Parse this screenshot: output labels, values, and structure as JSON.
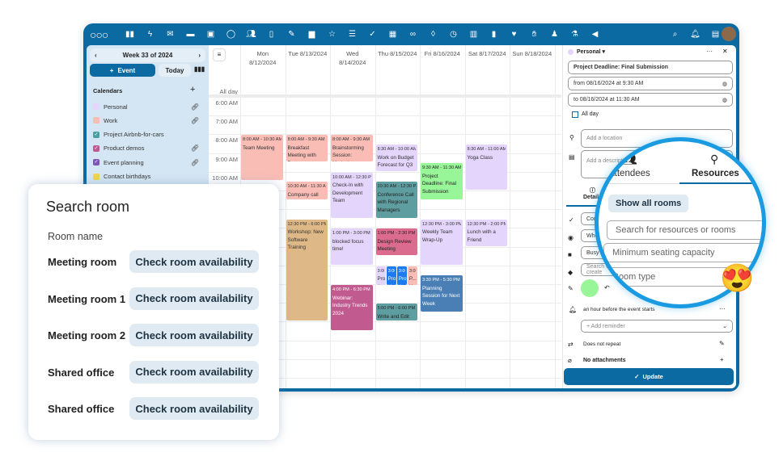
{
  "topbar": {
    "apps": [
      "dashboard-icon",
      "activity-icon",
      "mail-icon",
      "files-icon",
      "photos-icon",
      "talk-icon",
      "contacts-icon",
      "calendar-icon",
      "notes-icon",
      "deck-icon",
      "starred-icon",
      "tasks-icon",
      "check-icon",
      "tables-icon",
      "link-icon",
      "maps-icon",
      "speed-icon",
      "transport-icon",
      "bag-icon",
      "health-icon",
      "gestures-icon",
      "user-icon",
      "microscope-icon",
      "announce-icon"
    ],
    "right": [
      "search-icon",
      "notifications-icon",
      "contacts-menu-icon"
    ]
  },
  "sidebar": {
    "week": "Week 33 of 2024",
    "new_event": "Event",
    "today": "Today",
    "calendars_title": "Calendars",
    "calendars": [
      {
        "label": "Personal",
        "color": "#e3d5fb",
        "checked": false,
        "shared": true
      },
      {
        "label": "Work",
        "color": "#f9bdb6",
        "checked": false,
        "shared": true
      },
      {
        "label": "Project Airbnb-for-cars",
        "color": "#4aa0a0",
        "checked": true,
        "shared": false
      },
      {
        "label": "Product demos",
        "color": "#c05a8f",
        "checked": true,
        "shared": true
      },
      {
        "label": "Event planning",
        "color": "#7d55b5",
        "checked": true,
        "shared": true
      },
      {
        "label": "Contact birthdays",
        "color": "#f0d64a",
        "checked": false,
        "shared": false
      }
    ]
  },
  "grid": {
    "allday": "All day",
    "days": [
      [
        "Mon",
        "8/12/2024"
      ],
      [
        "Tue 8/13/2024",
        ""
      ],
      [
        "Wed",
        "8/14/2024"
      ],
      [
        "Thu 8/15/2024",
        ""
      ],
      [
        "Fri 8/16/2024",
        ""
      ],
      [
        "Sat 8/17/2024",
        ""
      ],
      [
        "Sun 8/18/2024",
        ""
      ]
    ],
    "times": [
      "6:00 AM",
      "7:00 AM",
      "8:00 AM",
      "9:00 AM",
      "10:00 AM"
    ],
    "events": [
      {
        "day": 0,
        "start": 8,
        "end": 10.5,
        "time": "8:00 AM - 10:30 AM",
        "title": "Team Meeting",
        "color": "#f9bdb6",
        "fg": "#333"
      },
      {
        "day": 1,
        "start": 8,
        "end": 9.5,
        "time": "8:00 AM - 9:30 AM",
        "title": "Breakfast Meeting with Partners",
        "color": "#f9bdb6",
        "fg": "#333"
      },
      {
        "day": 1,
        "start": 10.5,
        "end": 11.5,
        "time": "10:30 AM - 11:30 AM",
        "title": "Company call",
        "color": "#f9bdb6",
        "fg": "#333"
      },
      {
        "day": 1,
        "start": 12.5,
        "end": 18,
        "time": "12:30 PM - 6:00 PM",
        "title": "Workshop: New Software Training",
        "color": "#deb887",
        "fg": "#333"
      },
      {
        "day": 2,
        "start": 8,
        "end": 9.5,
        "time": "8:00 AM - 9:30 AM",
        "title": "Brainstorming Session: Marketing",
        "color": "#f9bdb6",
        "fg": "#333"
      },
      {
        "day": 2,
        "start": 10,
        "end": 12.5,
        "time": "10:00 AM - 12:30 PM",
        "title": "Check-In with Development Team",
        "color": "#e3d5fb",
        "fg": "#333"
      },
      {
        "day": 2,
        "start": 13,
        "end": 15,
        "time": "1:00 PM - 3:00 PM",
        "title": "blocked focus time!",
        "color": "#e3d5fb",
        "fg": "#333"
      },
      {
        "day": 2,
        "start": 16,
        "end": 18.5,
        "time": "4:00 PM - 6:30 PM",
        "title": "Webinar: Industry Trends 2024",
        "color": "#c05a8f",
        "fg": "#fff"
      },
      {
        "day": 3,
        "start": 8.5,
        "end": 10,
        "time": "8:30 AM - 10:00 AM",
        "title": "Work on Budget Forecast for Q3",
        "color": "#e3d5fb",
        "fg": "#333"
      },
      {
        "day": 3,
        "start": 10.5,
        "end": 12.5,
        "time": "10:30 AM - 12:30 PM",
        "title": "Conference Call with Regional Managers",
        "color": "#5f9ea0",
        "fg": "#222"
      },
      {
        "day": 3,
        "start": 13,
        "end": 14.5,
        "time": "1:00 PM - 2:30 PM",
        "title": "Design Review Meeting",
        "color": "#db6b8f",
        "fg": "#222"
      },
      {
        "day": 3,
        "start": 15,
        "end": 16.1,
        "time": "3:00",
        "title": "Pro the",
        "color": "#e3d5fb",
        "fg": "#333",
        "slot": 0,
        "slots": 4
      },
      {
        "day": 3,
        "start": 15,
        "end": 16.1,
        "time": "3:00",
        "title": "Pro Kick",
        "color": "#1a7cf0",
        "fg": "#fff",
        "slot": 1,
        "slots": 4
      },
      {
        "day": 3,
        "start": 15,
        "end": 16.1,
        "time": "3:00",
        "title": "Pro the",
        "color": "#1a7cf0",
        "fg": "#fff",
        "slot": 2,
        "slots": 4
      },
      {
        "day": 3,
        "start": 15,
        "end": 16.1,
        "time": "3:00",
        "title": "P... K",
        "color": "#f9bdb6",
        "fg": "#333",
        "slot": 3,
        "slots": 4
      },
      {
        "day": 3,
        "start": 17,
        "end": 18,
        "time": "5:00 PM - 6:00 PM",
        "title": "Write and Edit Blog Post for",
        "color": "#5f9ea0",
        "fg": "#222"
      },
      {
        "day": 4,
        "start": 9.5,
        "end": 11.5,
        "time": "9:30 AM - 11:30 AM",
        "title": "Project Deadline: Final Submission",
        "color": "#98f598",
        "fg": "#222"
      },
      {
        "day": 4,
        "start": 12.5,
        "end": 15,
        "time": "12:30 PM - 3:00 PM",
        "title": "Weekly Team Wrap-Up",
        "color": "#e3d5fb",
        "fg": "#333"
      },
      {
        "day": 4,
        "start": 15.5,
        "end": 17.5,
        "time": "3:30 PM - 5:30 PM",
        "title": "Planning Session for Next Week",
        "color": "#4a7fb5",
        "fg": "#fff"
      },
      {
        "day": 5,
        "start": 8.5,
        "end": 11,
        "time": "8:30 AM - 11:00 AM",
        "title": "Yoga Class",
        "color": "#e3d5fb",
        "fg": "#333"
      },
      {
        "day": 5,
        "start": 12.5,
        "end": 14,
        "time": "12:30 PM - 2:00 PM",
        "title": "Lunch with a Friend",
        "color": "#e3d5fb",
        "fg": "#333"
      }
    ]
  },
  "panel": {
    "calendar": "Personal",
    "title": "Project Deadline: Final Submission",
    "from": "from 08/16/2024 at 9:30 AM",
    "to": "to 08/16/2024 at 11:30 AM",
    "allday": "All day",
    "location_ph": "Add a location",
    "description_ph": "Add a description",
    "details_tab": "Details",
    "status": "Confirmed",
    "visibility": "When shared",
    "busy": "Busy",
    "tags_ph": "Search or create",
    "color": "#98f598",
    "reminder": "an hour before the event starts",
    "add_reminder": "+ Add reminder",
    "repeat": "Does not repeat",
    "attachments": "No attachments",
    "update": "Update"
  },
  "magnifier": {
    "attendees": "Attendees",
    "resources": "Resources",
    "show_all": "Show all rooms",
    "search_ph": "Search for resources or rooms",
    "capacity_ph": "Minimum seating capacity",
    "room_type_ph": "Room type"
  },
  "search_room": {
    "title": "Search room",
    "label": "Room name",
    "check": "Check room availability",
    "rooms": [
      "Meeting room",
      "Meeting room 1",
      "Meeting room 2",
      "Shared office",
      "Shared office"
    ]
  },
  "emoji": "😍"
}
